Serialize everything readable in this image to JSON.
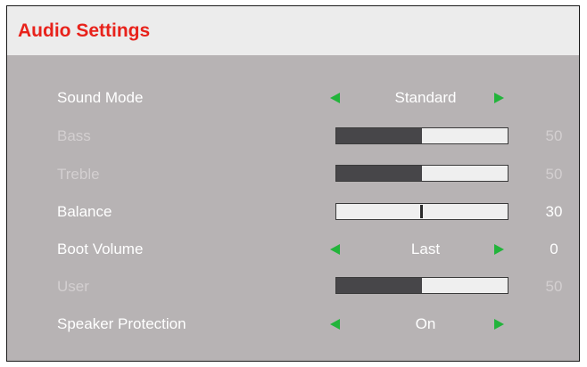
{
  "header": {
    "title": "Audio Settings"
  },
  "settings": [
    {
      "label": "Sound Mode",
      "type": "choice",
      "value": "Standard",
      "enabled": true
    },
    {
      "label": "Bass",
      "type": "slider",
      "level": 0.5,
      "value": "50",
      "enabled": false
    },
    {
      "label": "Treble",
      "type": "slider",
      "level": 0.5,
      "value": "50",
      "enabled": false
    },
    {
      "label": "Balance",
      "type": "balance",
      "level": 0.5,
      "value": "30",
      "enabled": true
    },
    {
      "label": "Boot Volume",
      "type": "choice",
      "value": "Last",
      "number": "0",
      "enabled": true
    },
    {
      "label": "User",
      "type": "slider",
      "level": 0.5,
      "value": "50",
      "enabled": false
    },
    {
      "label": "Speaker Protection",
      "type": "choice",
      "value": "On",
      "enabled": true
    }
  ],
  "colors": {
    "title": "#e8221b",
    "header_bg": "#ececec",
    "panel_bg": "#b7b3b4",
    "arrow": "#22b43b",
    "bar_fill": "#474649",
    "bar_track": "#efefef",
    "label_enabled": "#ffffff",
    "label_disabled": "#d3cfd0"
  },
  "icons": {
    "decrease": "triangle-left-icon",
    "increase": "triangle-right-icon"
  }
}
